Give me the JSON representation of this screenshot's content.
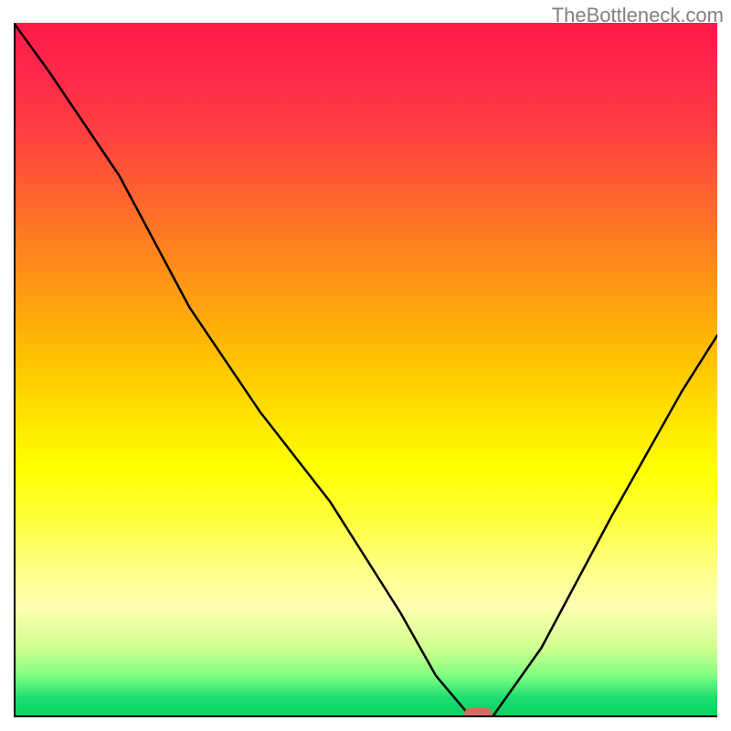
{
  "watermark": "TheBottleneck.com",
  "chart_data": {
    "type": "line",
    "title": "",
    "xlabel": "",
    "ylabel": "",
    "x": [
      0,
      5,
      15,
      25,
      35,
      45,
      55,
      60,
      65,
      68,
      75,
      85,
      95,
      100
    ],
    "values": [
      100,
      93,
      78,
      59,
      44,
      31,
      15,
      6,
      0,
      0,
      10,
      29,
      47,
      55
    ],
    "ylim": [
      0,
      100
    ],
    "xlim": [
      0,
      100
    ],
    "optimum_marker": {
      "x": 66,
      "y": 0
    },
    "background": "rainbow-vertical-gradient",
    "grid": false
  },
  "colors": {
    "curve": "#000000",
    "marker": "#d86a64",
    "watermark": "#808080"
  }
}
